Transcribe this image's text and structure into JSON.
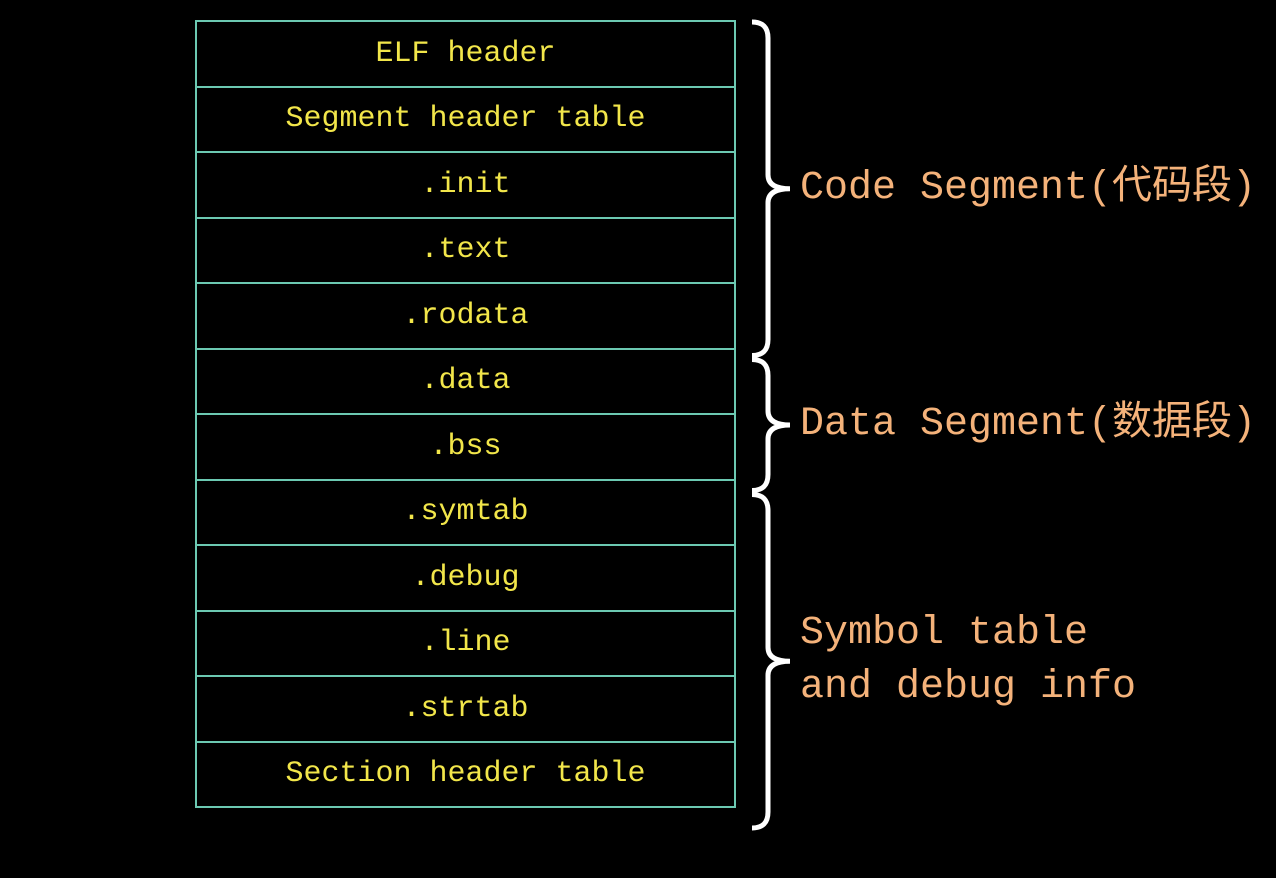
{
  "sections": [
    "ELF header",
    "Segment header table",
    ".init",
    ".text",
    ".rodata",
    ".data",
    ".bss",
    ".symtab",
    ".debug",
    ".line",
    ".strtab",
    "Section header table"
  ],
  "groups": [
    {
      "label": "Code Segment(代码段)",
      "first_section": 0,
      "last_section": 4
    },
    {
      "label": "Data Segment(数据段)",
      "first_section": 5,
      "last_section": 6
    },
    {
      "label": "Symbol table\nand debug info",
      "first_section": 7,
      "last_section": 11
    }
  ],
  "colors": {
    "section_text": "#f2e64a",
    "border": "#6cc9b2",
    "group_label": "#f4b27a",
    "brace": "#ffffff",
    "background": "#000000"
  }
}
